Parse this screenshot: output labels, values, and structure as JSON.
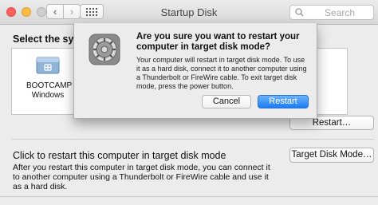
{
  "window": {
    "title": "Startup Disk",
    "search_placeholder": "Search",
    "icons": {
      "back": "chevron-left-icon",
      "forward": "chevron-right-icon",
      "grid": "grid-icon",
      "search": "search-icon"
    }
  },
  "main": {
    "select_label": "Select the syste",
    "disks": [
      {
        "name": "BOOTCAMP",
        "os": "Windows",
        "icon": "hard-drive-icon"
      }
    ],
    "restart_button": "Restart…",
    "target_mode": {
      "title": "Click to restart this computer in target disk mode",
      "description": "After you restart this computer in target disk mode, you can connect it to another computer using a Thunderbolt or FireWire cable and use it as a hard disk.",
      "button": "Target Disk Mode…"
    }
  },
  "dialog": {
    "icon": "system-preferences-icon",
    "title": "Are you sure you want to restart your computer in target disk mode?",
    "message": "Your computer will restart in target disk mode. To use it as a hard disk, connect it to another computer using a Thunderbolt or FireWire cable. To exit target disk mode, press the power button.",
    "cancel": "Cancel",
    "confirm": "Restart"
  },
  "colors": {
    "primary_button": "#1b7cf3",
    "close_light": "#fc605c",
    "minimize_light": "#fdbc40"
  }
}
